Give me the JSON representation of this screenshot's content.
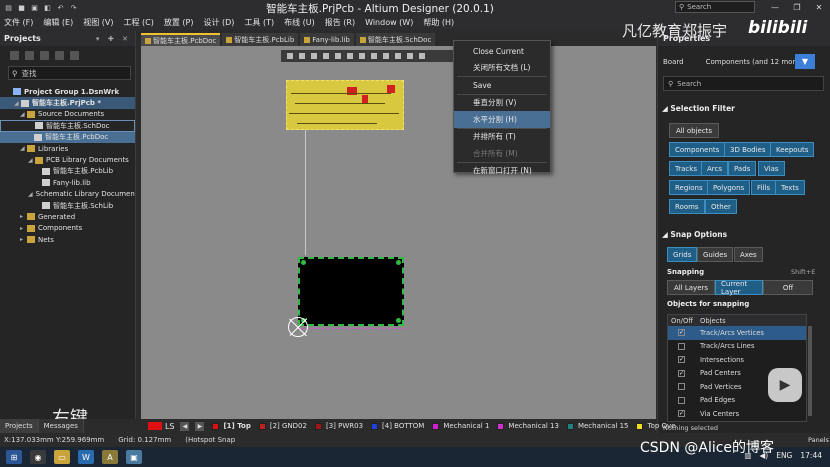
{
  "window": {
    "title": "智能车主板.PrjPcb - Altium Designer (20.0.1)",
    "search_placeholder": "Search"
  },
  "menu": [
    "文件 (F)",
    "编辑 (E)",
    "视图 (V)",
    "工程 (C)",
    "放置 (P)",
    "设计 (D)",
    "工具 (T)",
    "布线 (U)",
    "报告 (R)",
    "Window (W)",
    "帮助 (H)"
  ],
  "projects_panel": {
    "title": "Projects",
    "search_placeholder": "查找",
    "tree": [
      {
        "label": "Project Group 1.DsnWrk",
        "level": 0,
        "type": "grp"
      },
      {
        "label": "智能车主板.PrjPcb *",
        "level": 1,
        "type": "doc"
      },
      {
        "label": "Source Documents",
        "level": 2,
        "type": "folder"
      },
      {
        "label": "智能车主板.SchDoc",
        "level": 3,
        "type": "doc"
      },
      {
        "label": "智能车主板.PcbDoc",
        "level": 3,
        "type": "doc"
      },
      {
        "label": "Libraries",
        "level": 2,
        "type": "folder"
      },
      {
        "label": "PCB Library Documents",
        "level": 3,
        "type": "folder"
      },
      {
        "label": "智能车主板.PcbLib",
        "level": 4,
        "type": "doc"
      },
      {
        "label": "Fany-lib.lib",
        "level": 4,
        "type": "doc"
      },
      {
        "label": "Schematic Library Documents",
        "level": 3,
        "type": "folder"
      },
      {
        "label": "智能车主板.SchLib",
        "level": 4,
        "type": "doc"
      },
      {
        "label": "Generated",
        "level": 2,
        "type": "folder"
      },
      {
        "label": "Components",
        "level": 2,
        "type": "folder"
      },
      {
        "label": "Nets",
        "level": 2,
        "type": "folder"
      }
    ],
    "overlay_text": "右键"
  },
  "doc_tabs": [
    "智能车主板.PcbDoc",
    "智能车主板.PcbLib",
    "Fany-lib.lib",
    "智能车主板.SchDoc"
  ],
  "context_menu": {
    "items": [
      {
        "label": "Close Current",
        "state": "normal"
      },
      {
        "label": "关闭所有文档 (L)",
        "state": "normal"
      },
      {
        "label": "Save",
        "state": "normal"
      },
      {
        "label": "垂直分割 (V)",
        "state": "normal"
      },
      {
        "label": "水平分割 (H)",
        "state": "highlight"
      },
      {
        "label": "并排所有 (T)",
        "state": "normal"
      },
      {
        "label": "合并所有 (M)",
        "state": "disabled"
      },
      {
        "label": "在新窗口打开 (N)",
        "state": "normal"
      }
    ]
  },
  "properties": {
    "title": "Properties",
    "board_label": "Board",
    "board_value": "Components (and 12 more)",
    "search_placeholder": "Search",
    "selection_filter": "Selection Filter",
    "all_objects": "All objects",
    "filters": [
      "Components",
      "3D Bodies",
      "Keepouts",
      "Tracks",
      "Arcs",
      "Pads",
      "Vias",
      "Regions",
      "Polygons",
      "Fills",
      "Texts",
      "Rooms",
      "Other"
    ],
    "snap_options": "Snap Options",
    "snap_modes": [
      "Grids",
      "Guides",
      "Axes"
    ],
    "snapping_label": "Snapping",
    "snapping_hotkey": "Shift+E",
    "snapping_opts": [
      "All Layers",
      "Current Layer",
      "Off"
    ],
    "objects_for_snapping": "Objects for snapping",
    "table_headers": [
      "On/Off",
      "Objects"
    ],
    "snap_objects": [
      {
        "name": "Track/Arcs Vertices",
        "on": true
      },
      {
        "name": "Track/Arcs Lines",
        "on": false
      },
      {
        "name": "Intersections",
        "on": true
      },
      {
        "name": "Pad Centers",
        "on": true
      },
      {
        "name": "Pad Vertices",
        "on": false
      },
      {
        "name": "Pad Edges",
        "on": false
      },
      {
        "name": "Via Centers",
        "on": true
      }
    ],
    "nothing_selected": "Nothing selected"
  },
  "bottom_tabs": [
    "Projects",
    "Messages"
  ],
  "layer_bar": {
    "ls": "LS",
    "layers": [
      {
        "name": "[1] Top",
        "color": "#e01010",
        "bold": true
      },
      {
        "name": "[2] GND02",
        "color": "#c02020",
        "bold": false
      },
      {
        "name": "[3] PWR03",
        "color": "#a01818",
        "bold": false
      },
      {
        "name": "[4] BOTTOM",
        "color": "#2040e0",
        "bold": false
      },
      {
        "name": "Mechanical 1",
        "color": "#d020d0",
        "bold": false
      },
      {
        "name": "Mechanical 13",
        "color": "#d030d0",
        "bold": false
      },
      {
        "name": "Mechanical 15",
        "color": "#208080",
        "bold": false
      },
      {
        "name": "Top Ove",
        "color": "#f0e020",
        "bold": false
      }
    ]
  },
  "status": {
    "coords": "X:137.033mm Y:259.969mm",
    "grid": "Grid: 0.127mm",
    "mode": "(Hotspot Snap",
    "panels": "Panels"
  },
  "watermarks": {
    "channel": "凡亿教育郑振宇",
    "site": "bilibili",
    "csdn": "CSDN @Alice的博客"
  },
  "tray": {
    "lang": "ENG",
    "time": "17:44"
  }
}
